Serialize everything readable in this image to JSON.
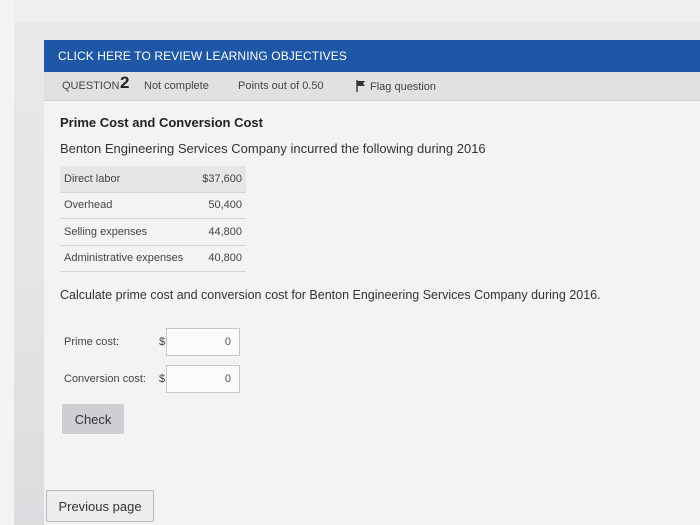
{
  "banner": {
    "text": "CLICK HERE TO REVIEW LEARNING OBJECTIVES"
  },
  "question_bar": {
    "label": "QUESTION",
    "number": "2",
    "status": "Not complete",
    "points": "Points out of 0.50",
    "flag_label": "Flag question",
    "flag_icon": "flag-icon"
  },
  "question": {
    "title": "Prime Cost and Conversion Cost",
    "intro": "Benton Engineering Services Company incurred the following during 2016",
    "rows": [
      {
        "label": "Direct labor",
        "amount": "$37,600"
      },
      {
        "label": "Overhead",
        "amount": "50,400"
      },
      {
        "label": "Selling expenses",
        "amount": "44,800"
      },
      {
        "label": "Administrative expenses",
        "amount": "40,800"
      }
    ],
    "prompt": "Calculate prime cost and conversion cost for Benton Engineering Services Company during 2016."
  },
  "answers": {
    "prime_label": "Prime cost:",
    "prime_currency": "$",
    "prime_value": "0",
    "conversion_label": "Conversion cost:",
    "conversion_currency": "$",
    "conversion_value": "0"
  },
  "buttons": {
    "check": "Check",
    "previous": "Previous page"
  },
  "colors": {
    "banner": "#1d57a6",
    "background": "#f3f3f4"
  }
}
